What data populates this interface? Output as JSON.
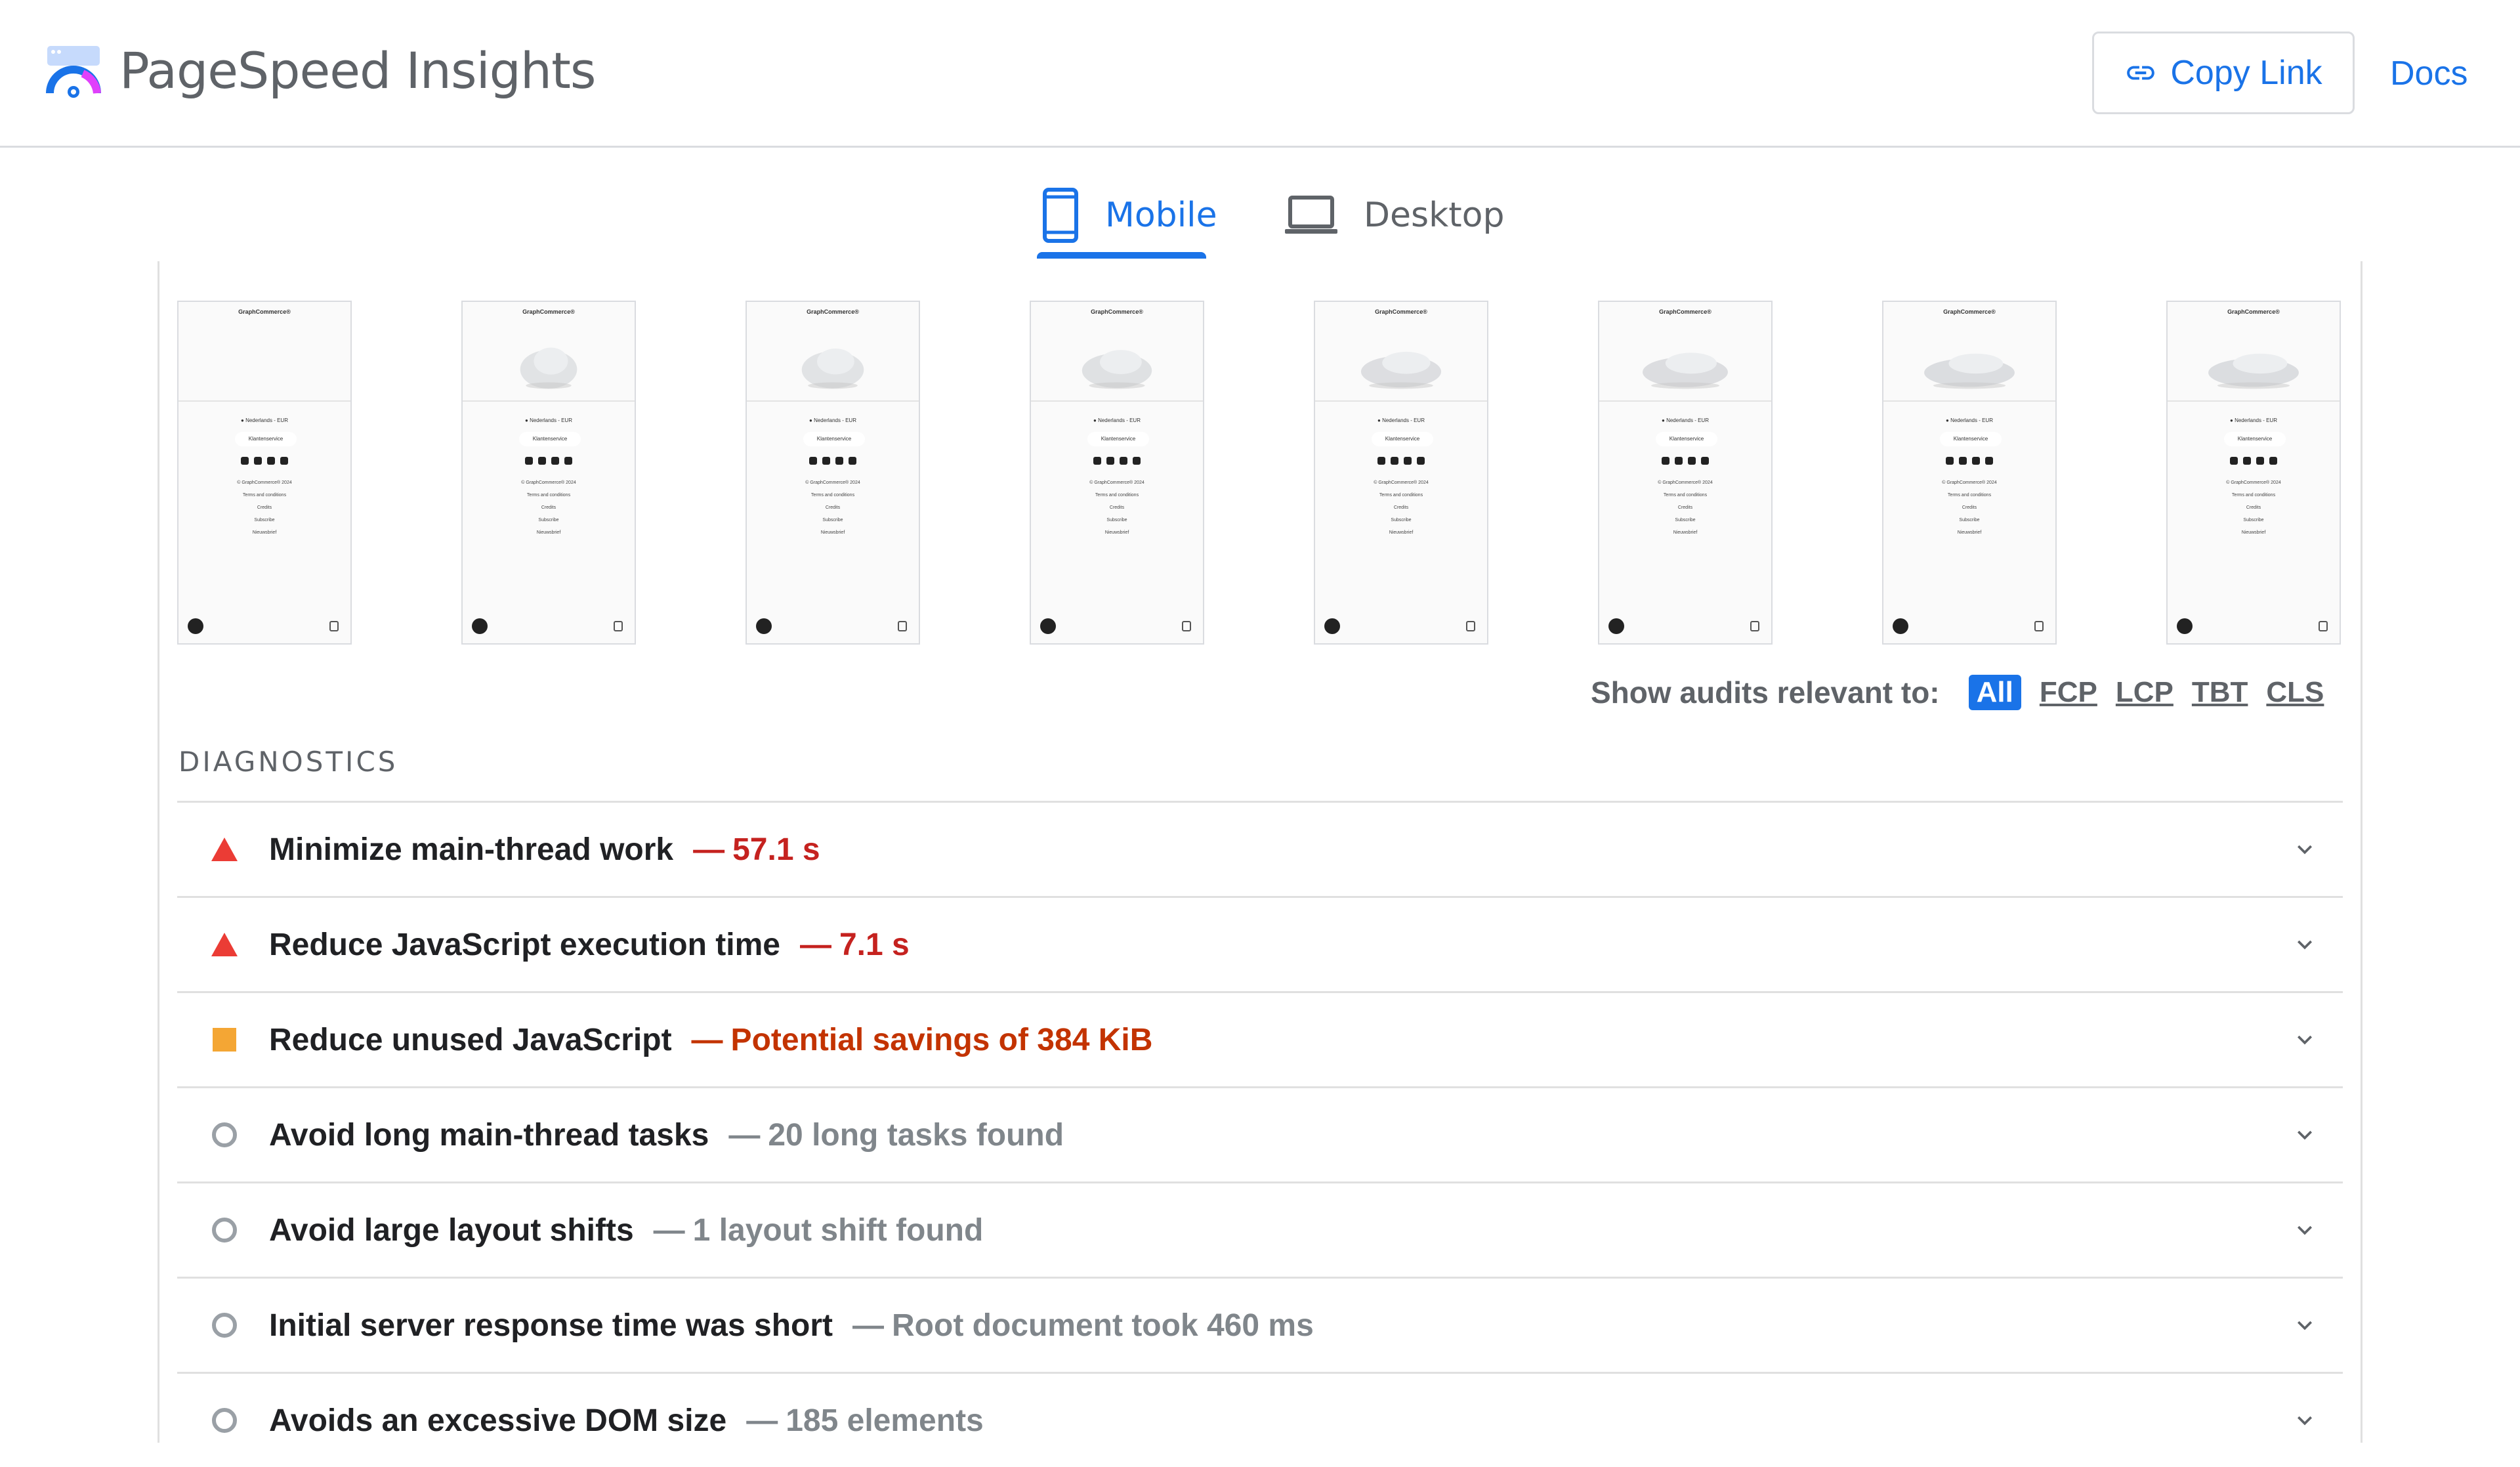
{
  "header": {
    "title": "PageSpeed Insights",
    "copy_link_label": "Copy Link",
    "docs_label": "Docs"
  },
  "tabs": [
    {
      "label": "Mobile",
      "selected": true
    },
    {
      "label": "Desktop",
      "selected": false
    }
  ],
  "filmstrip": {
    "frame_count": 8,
    "frame": {
      "brand": "GraphCommerce®",
      "language": "Nederlands - EUR",
      "service": "Klantenservice",
      "links": [
        "© GraphCommerce® 2024",
        "Terms and conditions",
        "Credits",
        "Subscribe",
        "Nieuwsbrief"
      ]
    },
    "shoe_progress": [
      0,
      0.35,
      0.45,
      0.6,
      0.8,
      0.9,
      1,
      1
    ]
  },
  "filter": {
    "label": "Show audits relevant to:",
    "options": [
      "All",
      "FCP",
      "LCP",
      "TBT",
      "CLS"
    ],
    "selected": "All"
  },
  "diagnostics": {
    "title": "DIAGNOSTICS",
    "items": [
      {
        "status": "fail",
        "icon": "red-triangle-icon",
        "title": "Minimize main-thread work",
        "value": "57.1 s"
      },
      {
        "status": "fail",
        "icon": "red-triangle-icon",
        "title": "Reduce JavaScript execution time",
        "value": "7.1 s"
      },
      {
        "status": "average",
        "icon": "orange-square-icon",
        "title": "Reduce unused JavaScript",
        "value": "Potential savings of 384 KiB"
      },
      {
        "status": "info",
        "icon": "gray-circle-icon",
        "title": "Avoid long main-thread tasks",
        "value": "20 long tasks found"
      },
      {
        "status": "info",
        "icon": "gray-circle-icon",
        "title": "Avoid large layout shifts",
        "value": "1 layout shift found"
      },
      {
        "status": "info",
        "icon": "gray-circle-icon",
        "title": "Initial server response time was short",
        "value": "Root document took 460 ms"
      },
      {
        "status": "info",
        "icon": "gray-circle-icon",
        "title": "Avoids an excessive DOM size",
        "value": "185 elements"
      }
    ]
  },
  "colors": {
    "accent": "#1a73e8",
    "fail": "#c5221f",
    "fail_icon": "#eb3c35",
    "average": "#c33300",
    "average_icon": "#f4a634",
    "info": "#80868b"
  }
}
